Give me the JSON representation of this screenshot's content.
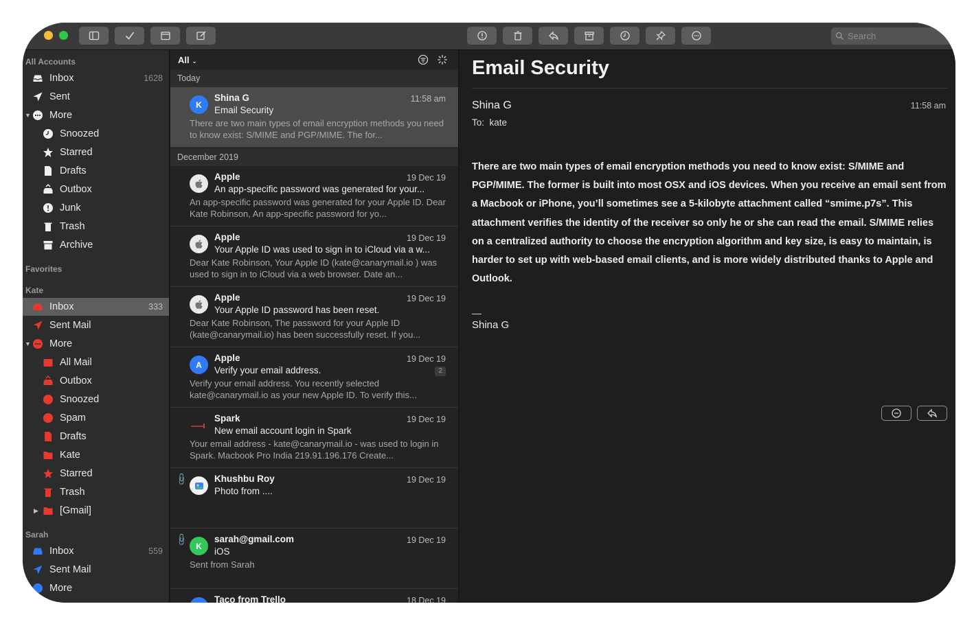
{
  "toolbar": {
    "left_buttons": [
      "sidebar-toggle-icon",
      "checkmark-icon",
      "calendar-icon",
      "compose-icon"
    ],
    "action_buttons": [
      "flag-icon",
      "trash-icon",
      "reply-icon",
      "archive-icon",
      "clock-icon",
      "pin-icon",
      "more-icon"
    ],
    "search_placeholder": "Search"
  },
  "sidebar": {
    "all_accounts_header": "All Accounts",
    "all_accounts": [
      {
        "label": "Inbox",
        "count": "1628"
      },
      {
        "label": "Sent"
      },
      {
        "label": "More"
      },
      {
        "label": "Snoozed"
      },
      {
        "label": "Starred"
      },
      {
        "label": "Drafts"
      },
      {
        "label": "Outbox"
      },
      {
        "label": "Junk"
      },
      {
        "label": "Trash"
      },
      {
        "label": "Archive"
      }
    ],
    "favorites_header": "Favorites",
    "kate_header": "Kate",
    "kate": [
      {
        "label": "Inbox",
        "count": "333"
      },
      {
        "label": "Sent Mail"
      },
      {
        "label": "More"
      },
      {
        "label": "All Mail"
      },
      {
        "label": "Outbox"
      },
      {
        "label": "Snoozed"
      },
      {
        "label": "Spam"
      },
      {
        "label": "Drafts"
      },
      {
        "label": "Kate"
      },
      {
        "label": "Starred"
      },
      {
        "label": "Trash"
      },
      {
        "label": "[Gmail]"
      }
    ],
    "sarah_header": "Sarah",
    "sarah": [
      {
        "label": "Inbox",
        "count": "559"
      },
      {
        "label": "Sent Mail"
      },
      {
        "label": "More"
      }
    ]
  },
  "list": {
    "filter": "All",
    "groups": [
      "Today",
      "December 2019"
    ],
    "messages": [
      {
        "avatar": "K",
        "from": "Shina G",
        "date": "11:58 am",
        "subject": "Email Security",
        "preview": "There are two main types of email encryption methods you need to know exist: S/MIME and PGP/MIME. The for..."
      },
      {
        "avatar": "",
        "from": "Apple",
        "date": "19 Dec 19",
        "subject": "An app-specific password was generated for your...",
        "preview": "An app-specific password was generated for your Apple ID. Dear Kate Robinson, An app-specific password for yo..."
      },
      {
        "avatar": "",
        "from": "Apple",
        "date": "19 Dec 19",
        "subject": "Your Apple ID was used to sign in to iCloud via a w...",
        "preview": "Dear Kate Robinson, Your Apple ID (kate@canarymail.io ) was used to sign in to iCloud via a web browser. Date an..."
      },
      {
        "avatar": "",
        "from": "Apple",
        "date": "19 Dec 19",
        "subject": "Your Apple ID password has been reset.",
        "preview": " Dear Kate Robinson, The password for your Apple ID (kate@canarymail.io) has been successfully reset. If you..."
      },
      {
        "avatar": "A",
        "from": "Apple",
        "date": "19 Dec 19",
        "subject": "Verify your email address.",
        "badge": "2",
        "preview": "Verify your email address. You recently selected kate@canarymail.io as your new Apple ID. To verify this..."
      },
      {
        "avatar": "",
        "from": "Spark",
        "date": "19 Dec 19",
        "subject": "New email account login in Spark",
        "preview": "Your email address - kate@canarymail.io - was used to login in Spark. Macbook Pro India 219.91.196.176 Create..."
      },
      {
        "avatar": "",
        "from": "Khushbu Roy",
        "date": "19 Dec 19",
        "subject": "Photo from ....",
        "preview": ""
      },
      {
        "avatar": "K",
        "from": "sarah@gmail.com",
        "date": "19 Dec 19",
        "subject": "iOS",
        "preview": "Sent from Sarah"
      },
      {
        "avatar": "",
        "from": "Taco from Trello",
        "date": "18 Dec 19",
        "subject": "",
        "preview": ""
      }
    ]
  },
  "reader": {
    "title": "Email Security",
    "from": "Shina G",
    "time": "11:58 am",
    "to_label": "To:",
    "to": "kate",
    "body": "There are two main types of email encryption methods you need to know exist: S/MIME and PGP/MIME. The former is built into most OSX and iOS devices. When you receive an email sent from a Macbook or iPhone, you’ll sometimes see a 5-kilobyte attachment called “smime.p7s”. This attachment verifies the identity of the receiver so only he or she can read the email. S/MIME relies on a centralized authority to choose the encryption algorithm and key size, is easy to maintain, is harder to set up with web-based email clients, and is more widely distributed thanks to Apple and Outlook.",
    "dash": "—",
    "signature": "Shina G"
  },
  "colors": {
    "accent_blue": "#2f7bf5",
    "kate_red": "#e8392f",
    "traffic_yellow": "#f5bd3c",
    "traffic_green": "#2fc847"
  }
}
